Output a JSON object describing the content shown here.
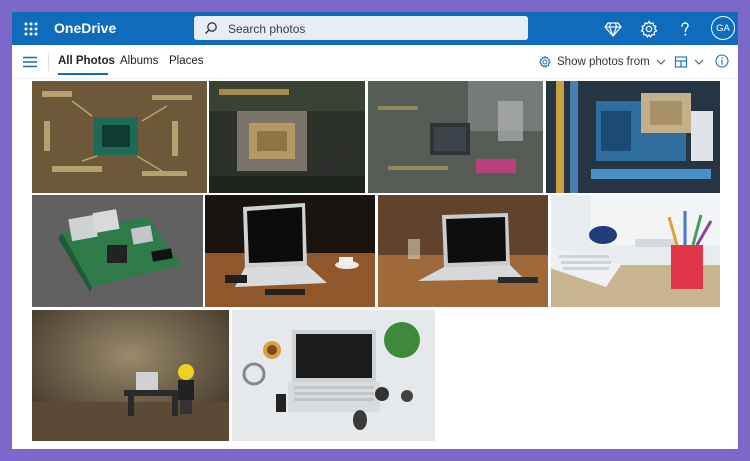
{
  "app": {
    "title": "OneDrive"
  },
  "search": {
    "placeholder": "Search photos"
  },
  "user": {
    "initials": "GA"
  },
  "nav": {
    "tabs": [
      {
        "label": "All Photos",
        "active": true
      },
      {
        "label": "Albums",
        "active": false
      },
      {
        "label": "Places",
        "active": false
      }
    ]
  },
  "filters": {
    "show_photos_from": "Show photos from"
  },
  "colors": {
    "topbar": "#0f6cbd",
    "frame": "#7b68c8",
    "accent": "#0f6cbd"
  },
  "icons": {
    "waffle": "app-launcher-icon",
    "search": "search-icon",
    "premium": "diamond-icon",
    "settings": "gear-icon",
    "help": "help-icon",
    "menu": "hamburger-icon",
    "filter": "settings-gear-icon",
    "layout": "layout-grid-icon",
    "info": "info-icon"
  },
  "photos": [
    {
      "subject": "circuit-board-chip"
    },
    {
      "subject": "cpu-socket-board"
    },
    {
      "subject": "intel-chip-board"
    },
    {
      "subject": "blue-motherboard"
    },
    {
      "subject": "raspberry-pi"
    },
    {
      "subject": "laptop-on-desk"
    },
    {
      "subject": "laptop-on-desk-2"
    },
    {
      "subject": "imac-keyboard-pencils"
    },
    {
      "subject": "lego-figure-desk"
    },
    {
      "subject": "laptop-top-view"
    }
  ]
}
